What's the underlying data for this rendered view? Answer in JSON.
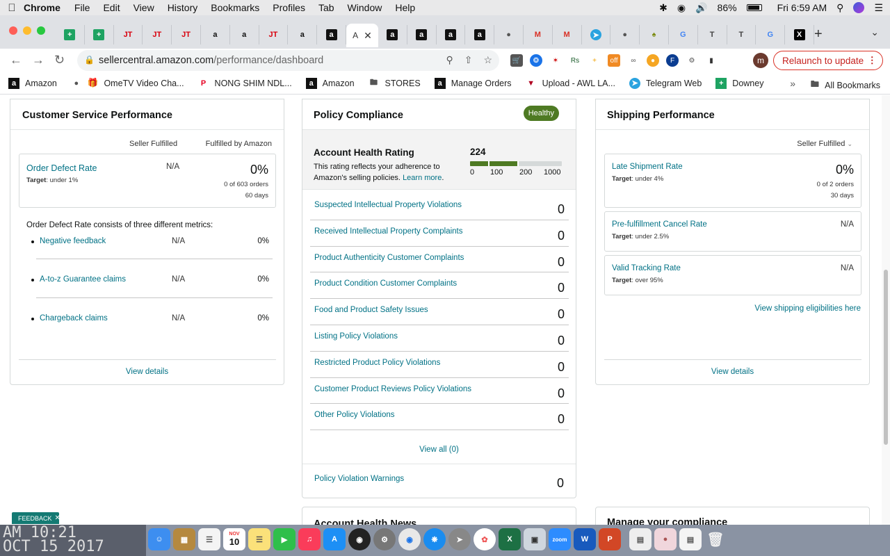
{
  "menubar": {
    "app": "Chrome",
    "items": [
      "File",
      "Edit",
      "View",
      "History",
      "Bookmarks",
      "Profiles",
      "Tab",
      "Window",
      "Help"
    ],
    "battery": "86%",
    "clock": "Fri 6:59 AM"
  },
  "browser": {
    "active_tab_label": "A",
    "url_host": "sellercentral.amazon.com",
    "url_path": "/performance/dashboard",
    "relaunch_label": "Relaunch to update",
    "profile_initial": "m"
  },
  "bookmarks": {
    "items": [
      "Amazon",
      "OmeTV Video Cha...",
      "NONG SHIM NDL...",
      "Amazon",
      "STORES",
      "Manage Orders",
      "Upload - AWL LA...",
      "Telegram Web",
      "Downey"
    ],
    "all_label": "All Bookmarks"
  },
  "csp": {
    "title": "Customer Service Performance",
    "col_seller": "Seller Fulfilled",
    "col_fba": "Fulfilled by Amazon",
    "odr_label": "Order Defect Rate",
    "odr_target_label": "Target",
    "odr_target": ": under 1%",
    "odr_seller": "N/A",
    "odr_fba": "0%",
    "odr_orders": "0 of 603 orders",
    "odr_days": "60 days",
    "metrics_intro": "Order Defect Rate consists of three different metrics:",
    "metrics": [
      {
        "label": "Negative feedback",
        "seller": "N/A",
        "fba": "0%"
      },
      {
        "label": "A-to-z Guarantee claims",
        "seller": "N/A",
        "fba": "0%"
      },
      {
        "label": "Chargeback claims",
        "seller": "N/A",
        "fba": "0%"
      }
    ],
    "view_details": "View details"
  },
  "policy": {
    "title": "Policy Compliance",
    "badge": "Healthy",
    "ahr_title": "Account Health Rating",
    "ahr_desc": "This rating reflects your adherence to Amazon's selling policies.",
    "learn_more": "Learn more",
    "ahr_score": "224",
    "ahr_fraction": 0.224,
    "scale_labels": [
      "0",
      "100",
      "200",
      "1000"
    ],
    "rows": [
      {
        "label": "Suspected Intellectual Property Violations",
        "count": "0"
      },
      {
        "label": "Received Intellectual Property Complaints",
        "count": "0"
      },
      {
        "label": "Product Authenticity Customer Complaints",
        "count": "0"
      },
      {
        "label": "Product Condition Customer Complaints",
        "count": "0"
      },
      {
        "label": "Food and Product Safety Issues",
        "count": "0"
      },
      {
        "label": "Listing Policy Violations",
        "count": "0"
      },
      {
        "label": "Restricted Product Policy Violations",
        "count": "0"
      },
      {
        "label": "Customer Product Reviews Policy Violations",
        "count": "0"
      },
      {
        "label": "Other Policy Violations",
        "count": "0"
      }
    ],
    "view_all": "View all (0)",
    "warnings_label": "Policy Violation Warnings",
    "warnings_count": "0",
    "next_card_title": "Account Health News"
  },
  "shipping": {
    "title": "Shipping Performance",
    "filter": "Seller Fulfilled",
    "metrics": [
      {
        "label": "Late Shipment Rate",
        "target_label": "Target",
        "target": ": under 4%",
        "value": "0%",
        "orders": "0 of 2 orders",
        "days": "30 days"
      },
      {
        "label": "Pre-fulfillment Cancel Rate",
        "target_label": "Target",
        "target": ": under 2.5%",
        "value": "N/A"
      },
      {
        "label": "Valid Tracking Rate",
        "target_label": "Target",
        "target": ": over 95%",
        "value": "N/A"
      }
    ],
    "eligibility_link": "View shipping eligibilities here",
    "view_details": "View details",
    "next_card_title": "Manage your compliance"
  },
  "feedback_label": "FEEDBACK",
  "dock": {
    "clock_line1": "AM 10:21",
    "clock_line2": "OCT 15 2017",
    "calendar_month": "NOV",
    "calendar_day": "10"
  },
  "colors": {
    "link": "#007185",
    "healthy": "#4e7a23",
    "feedback": "#147a73",
    "relaunch": "#c5221f"
  }
}
